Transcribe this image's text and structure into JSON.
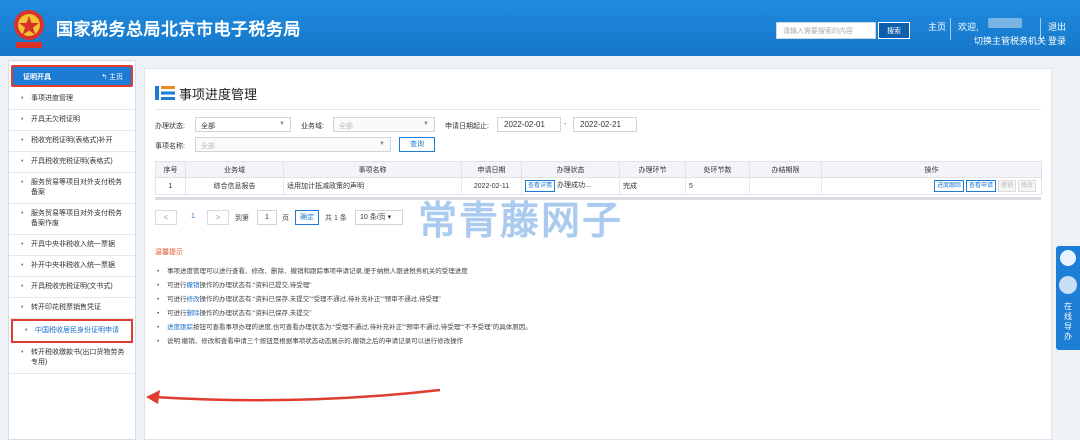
{
  "header": {
    "title": "国家税务总局北京市电子税务局",
    "search_placeholder": "请输入需要搜索的内容",
    "search_button": "搜索",
    "home_link": "主页",
    "welcome": "欢迎,",
    "switch_org": "切换主管税务机关",
    "logout_line1": "退出",
    "logout_line2": "登录"
  },
  "sidebar": {
    "title": "证明开具",
    "home": "主页",
    "items": [
      {
        "label": "事项进度管理"
      },
      {
        "label": "开具无欠税证明"
      },
      {
        "label": "税收完税证明(表格式)补开"
      },
      {
        "label": "开具税收完税证明(表格式)"
      },
      {
        "label": "服务贸易等项目对外支付税务备案"
      },
      {
        "label": "服务贸易等项目对外支付税务备案作废"
      },
      {
        "label": "开具中央非税收入统一票据"
      },
      {
        "label": "补开中央非税收入统一票据"
      },
      {
        "label": "开具税收完税证明(文书式)"
      },
      {
        "label": "转开印花税票销售凭证"
      },
      {
        "label": "中国税收居民身份证明申请"
      },
      {
        "label": "转开税收缴款书(出口货物劳务专用)"
      }
    ]
  },
  "float_tab": {
    "label": "在线导办"
  },
  "page": {
    "title": "事项进度管理"
  },
  "filters": {
    "status_label": "办理状态:",
    "status_value": "全部",
    "domain_label": "业务域:",
    "domain_value": "全部",
    "date_label": "申请日期起止:",
    "date_from": "2022-02-01",
    "date_sep": "-",
    "date_to": "2022-02-21",
    "item_label": "事项名称:",
    "item_value": "全部",
    "query_button": "查询"
  },
  "table": {
    "headers": [
      "序号",
      "业务域",
      "事项名称",
      "申请日期",
      "办理状态",
      "办理环节",
      "处环节数",
      "办结期限",
      "操作"
    ],
    "rows": [
      {
        "index": "1",
        "domain": "综合信息报告",
        "item": "适用加计抵减政策的声明",
        "date": "2022-02-11",
        "status_btn": "查看详情",
        "status": "办理成功...",
        "stage": "完成",
        "steps": "5",
        "deadline": "",
        "actions": [
          "进度跟踪",
          "查看申请",
          "撤销",
          "修改"
        ]
      }
    ]
  },
  "pagination": {
    "prev": "<",
    "page": "1",
    "next": ">",
    "goto_label": "到第",
    "goto_value": "1",
    "page_unit": "页",
    "confirm": "确定",
    "total": "共 1 条",
    "page_size": "10 条/页"
  },
  "tips": {
    "title": "温馨提示",
    "items": [
      {
        "text": "事项进度管理可以进行查看、修改、删除、撤销和跟踪事项申请记录,便于纳税人跟进税务机关的受理进度"
      },
      {
        "pre": "可进行",
        "link": "撤销",
        "post": "操作的办理状态有:“资料已提交,待受理”"
      },
      {
        "pre": "可进行",
        "link": "修改",
        "post": "操作的办理状态有:“资料已保存,未提交”“受理不通过,待补充补正”“预审不通过,待受理”"
      },
      {
        "pre": "可进行",
        "link": "删除",
        "post": "操作的办理状态有:“资料已保存,未提交”"
      },
      {
        "pre": "",
        "link": "进度跟踪",
        "post": "按钮可查看事项办理的进度,也可查看办理状态为:“受理不通过,待补充补正”“预审不通过,待受理”“不予受理”的具体原因。"
      },
      {
        "text": "说明:撤销、修改和查看申请三个按钮是根据事项状态动态展示的,撤销之后的申请记录可以进行修改操作"
      }
    ]
  },
  "watermark": "常青藤网子",
  "colors": {
    "header": "#1677c8",
    "accent": "#1c7bd3",
    "highlight": "#e03c2f",
    "tip_title": "#e2532f"
  }
}
